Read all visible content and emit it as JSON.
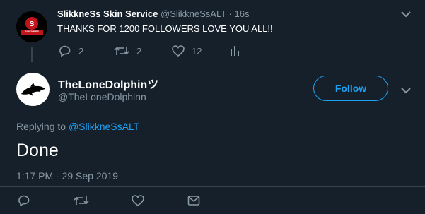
{
  "parent_tweet": {
    "display_name": "SlikkneSs Skin Service",
    "handle": "@SlikkneSsALT",
    "separator": "·",
    "time": "16s",
    "text": "THANKS FOR 1200 FOLLOWERS LOVE YOU ALL!!",
    "avatar_badge_text": "SLIKNESS",
    "reply_count": "2",
    "retweet_count": "2",
    "like_count": "12"
  },
  "main_tweet": {
    "display_name": "TheLoneDolphinツ",
    "handle": "@TheLoneDolphinn",
    "follow_label": "Follow",
    "replying_prefix": "Replying to",
    "replying_handle": "@SlikkneSsALT",
    "text": "Done",
    "timestamp": "1:17 PM - 29 Sep 2019"
  },
  "colors": {
    "background": "#15202b",
    "accent": "#1da1f2",
    "muted": "#8899a6",
    "divider": "#38444d"
  },
  "icons": [
    "chevron-down-icon",
    "reply-icon",
    "retweet-icon",
    "like-icon",
    "analytics-icon",
    "message-icon",
    "dolphin-icon"
  ]
}
